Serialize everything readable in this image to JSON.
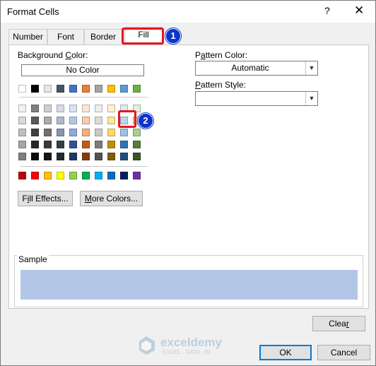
{
  "window": {
    "title": "Format Cells",
    "help": "?",
    "close": "✕"
  },
  "tabs": [
    {
      "label": "Number",
      "active": false
    },
    {
      "label": "Font",
      "active": false
    },
    {
      "label": "Border",
      "active": false
    },
    {
      "label": "Fill",
      "active": true
    }
  ],
  "badges": {
    "one": "1",
    "two": "2"
  },
  "fill": {
    "background_label": "Background Color:",
    "no_color": "No Color",
    "fill_effects": "Fill Effects...",
    "more_colors": "More Colors...",
    "pattern_color_label": "Pattern Color:",
    "pattern_color_value": "Automatic",
    "pattern_style_label": "Pattern Style:",
    "pattern_style_value": "",
    "sample_label": "Sample",
    "sample_color": "#b4c6e7"
  },
  "palette": {
    "top_row": [
      "#ffffff",
      "#000000",
      "#e7e6e6",
      "#44546a",
      "#4472c4",
      "#ed7d31",
      "#a5a5a5",
      "#ffc000",
      "#5b9bd5",
      "#70ad47"
    ],
    "tints": [
      [
        "#f2f2f2",
        "#808080",
        "#d0cece",
        "#d6dce4",
        "#d9e2f3",
        "#fbe5d5",
        "#ededed",
        "#fff2cc",
        "#deebf6",
        "#e2efd9"
      ],
      [
        "#d8d8d8",
        "#595959",
        "#aeabab",
        "#adb9ca",
        "#b4c6e7",
        "#f7cbac",
        "#dbdbdb",
        "#fee599",
        "#bdd7ee",
        "#c5e0b3"
      ],
      [
        "#bfbfbf",
        "#3f3f3f",
        "#757070",
        "#8496b0",
        "#8eaadb",
        "#f4b183",
        "#c9c9c9",
        "#ffd965",
        "#9cc3e5",
        "#a8d08d"
      ],
      [
        "#a5a5a5",
        "#262626",
        "#3a3838",
        "#323f4f",
        "#2f5496",
        "#c55a11",
        "#7b7b7b",
        "#bf9000",
        "#2e75b5",
        "#538135"
      ],
      [
        "#7f7f7f",
        "#0c0c0c",
        "#171616",
        "#222a35",
        "#1f3864",
        "#833c0b",
        "#525252",
        "#7f6000",
        "#1e4e79",
        "#375623"
      ]
    ],
    "standard": [
      "#c00000",
      "#ff0000",
      "#ffc000",
      "#ffff00",
      "#92d050",
      "#00b050",
      "#00b0f0",
      "#0070c0",
      "#002060",
      "#7030a0"
    ]
  },
  "buttons": {
    "clear": "Clear",
    "ok": "OK",
    "cancel": "Cancel"
  },
  "watermark": {
    "name": "exceldemy",
    "tagline": "EXCEL · DATA · BI"
  }
}
